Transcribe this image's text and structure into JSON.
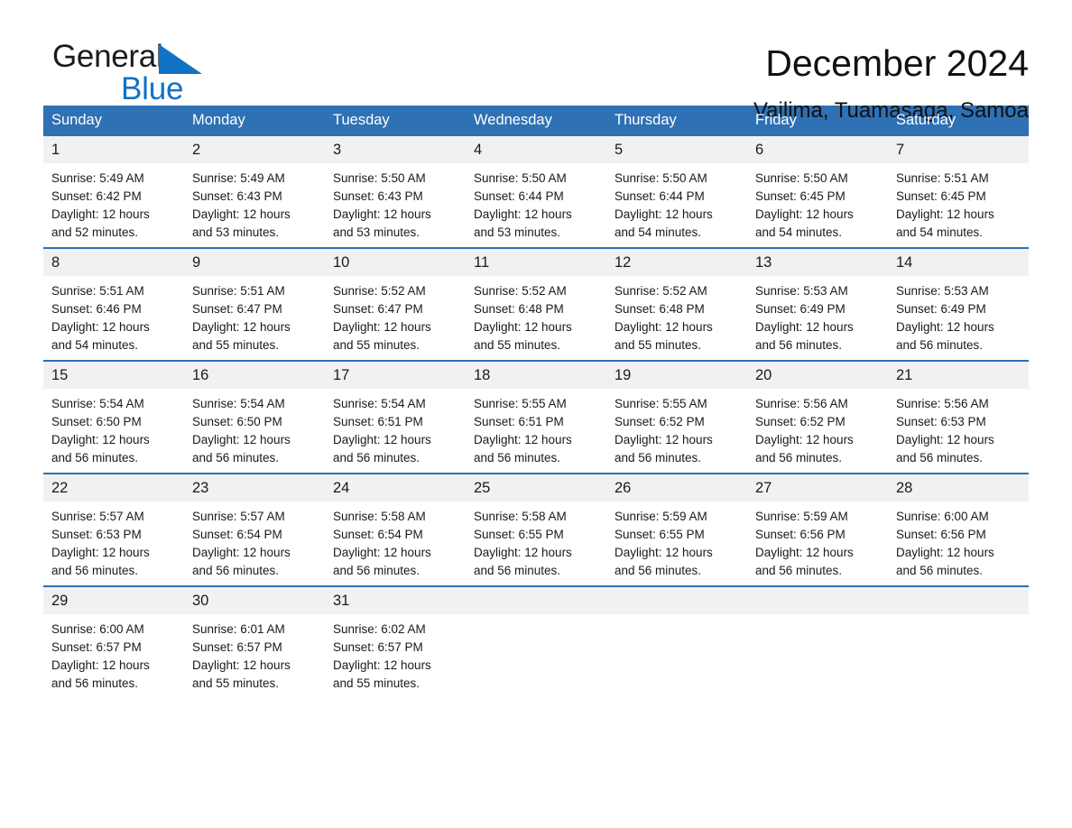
{
  "brand": {
    "name_top": "General",
    "name_bottom": "Blue",
    "triangle_icon": "blue-triangle-icon",
    "accent_color": "#1272c4"
  },
  "header": {
    "month_title": "December 2024",
    "location": "Vailima, Tuamasaga, Samoa"
  },
  "calendar": {
    "header_color": "#2e71b4",
    "daynum_band_color": "#f1f1f1",
    "weekday_headers": [
      "Sunday",
      "Monday",
      "Tuesday",
      "Wednesday",
      "Thursday",
      "Friday",
      "Saturday"
    ],
    "weeks": [
      [
        {
          "day": "1",
          "sunrise": "Sunrise: 5:49 AM",
          "sunset": "Sunset: 6:42 PM",
          "daylight_1": "Daylight: 12 hours",
          "daylight_2": "and 52 minutes."
        },
        {
          "day": "2",
          "sunrise": "Sunrise: 5:49 AM",
          "sunset": "Sunset: 6:43 PM",
          "daylight_1": "Daylight: 12 hours",
          "daylight_2": "and 53 minutes."
        },
        {
          "day": "3",
          "sunrise": "Sunrise: 5:50 AM",
          "sunset": "Sunset: 6:43 PM",
          "daylight_1": "Daylight: 12 hours",
          "daylight_2": "and 53 minutes."
        },
        {
          "day": "4",
          "sunrise": "Sunrise: 5:50 AM",
          "sunset": "Sunset: 6:44 PM",
          "daylight_1": "Daylight: 12 hours",
          "daylight_2": "and 53 minutes."
        },
        {
          "day": "5",
          "sunrise": "Sunrise: 5:50 AM",
          "sunset": "Sunset: 6:44 PM",
          "daylight_1": "Daylight: 12 hours",
          "daylight_2": "and 54 minutes."
        },
        {
          "day": "6",
          "sunrise": "Sunrise: 5:50 AM",
          "sunset": "Sunset: 6:45 PM",
          "daylight_1": "Daylight: 12 hours",
          "daylight_2": "and 54 minutes."
        },
        {
          "day": "7",
          "sunrise": "Sunrise: 5:51 AM",
          "sunset": "Sunset: 6:45 PM",
          "daylight_1": "Daylight: 12 hours",
          "daylight_2": "and 54 minutes."
        }
      ],
      [
        {
          "day": "8",
          "sunrise": "Sunrise: 5:51 AM",
          "sunset": "Sunset: 6:46 PM",
          "daylight_1": "Daylight: 12 hours",
          "daylight_2": "and 54 minutes."
        },
        {
          "day": "9",
          "sunrise": "Sunrise: 5:51 AM",
          "sunset": "Sunset: 6:47 PM",
          "daylight_1": "Daylight: 12 hours",
          "daylight_2": "and 55 minutes."
        },
        {
          "day": "10",
          "sunrise": "Sunrise: 5:52 AM",
          "sunset": "Sunset: 6:47 PM",
          "daylight_1": "Daylight: 12 hours",
          "daylight_2": "and 55 minutes."
        },
        {
          "day": "11",
          "sunrise": "Sunrise: 5:52 AM",
          "sunset": "Sunset: 6:48 PM",
          "daylight_1": "Daylight: 12 hours",
          "daylight_2": "and 55 minutes."
        },
        {
          "day": "12",
          "sunrise": "Sunrise: 5:52 AM",
          "sunset": "Sunset: 6:48 PM",
          "daylight_1": "Daylight: 12 hours",
          "daylight_2": "and 55 minutes."
        },
        {
          "day": "13",
          "sunrise": "Sunrise: 5:53 AM",
          "sunset": "Sunset: 6:49 PM",
          "daylight_1": "Daylight: 12 hours",
          "daylight_2": "and 56 minutes."
        },
        {
          "day": "14",
          "sunrise": "Sunrise: 5:53 AM",
          "sunset": "Sunset: 6:49 PM",
          "daylight_1": "Daylight: 12 hours",
          "daylight_2": "and 56 minutes."
        }
      ],
      [
        {
          "day": "15",
          "sunrise": "Sunrise: 5:54 AM",
          "sunset": "Sunset: 6:50 PM",
          "daylight_1": "Daylight: 12 hours",
          "daylight_2": "and 56 minutes."
        },
        {
          "day": "16",
          "sunrise": "Sunrise: 5:54 AM",
          "sunset": "Sunset: 6:50 PM",
          "daylight_1": "Daylight: 12 hours",
          "daylight_2": "and 56 minutes."
        },
        {
          "day": "17",
          "sunrise": "Sunrise: 5:54 AM",
          "sunset": "Sunset: 6:51 PM",
          "daylight_1": "Daylight: 12 hours",
          "daylight_2": "and 56 minutes."
        },
        {
          "day": "18",
          "sunrise": "Sunrise: 5:55 AM",
          "sunset": "Sunset: 6:51 PM",
          "daylight_1": "Daylight: 12 hours",
          "daylight_2": "and 56 minutes."
        },
        {
          "day": "19",
          "sunrise": "Sunrise: 5:55 AM",
          "sunset": "Sunset: 6:52 PM",
          "daylight_1": "Daylight: 12 hours",
          "daylight_2": "and 56 minutes."
        },
        {
          "day": "20",
          "sunrise": "Sunrise: 5:56 AM",
          "sunset": "Sunset: 6:52 PM",
          "daylight_1": "Daylight: 12 hours",
          "daylight_2": "and 56 minutes."
        },
        {
          "day": "21",
          "sunrise": "Sunrise: 5:56 AM",
          "sunset": "Sunset: 6:53 PM",
          "daylight_1": "Daylight: 12 hours",
          "daylight_2": "and 56 minutes."
        }
      ],
      [
        {
          "day": "22",
          "sunrise": "Sunrise: 5:57 AM",
          "sunset": "Sunset: 6:53 PM",
          "daylight_1": "Daylight: 12 hours",
          "daylight_2": "and 56 minutes."
        },
        {
          "day": "23",
          "sunrise": "Sunrise: 5:57 AM",
          "sunset": "Sunset: 6:54 PM",
          "daylight_1": "Daylight: 12 hours",
          "daylight_2": "and 56 minutes."
        },
        {
          "day": "24",
          "sunrise": "Sunrise: 5:58 AM",
          "sunset": "Sunset: 6:54 PM",
          "daylight_1": "Daylight: 12 hours",
          "daylight_2": "and 56 minutes."
        },
        {
          "day": "25",
          "sunrise": "Sunrise: 5:58 AM",
          "sunset": "Sunset: 6:55 PM",
          "daylight_1": "Daylight: 12 hours",
          "daylight_2": "and 56 minutes."
        },
        {
          "day": "26",
          "sunrise": "Sunrise: 5:59 AM",
          "sunset": "Sunset: 6:55 PM",
          "daylight_1": "Daylight: 12 hours",
          "daylight_2": "and 56 minutes."
        },
        {
          "day": "27",
          "sunrise": "Sunrise: 5:59 AM",
          "sunset": "Sunset: 6:56 PM",
          "daylight_1": "Daylight: 12 hours",
          "daylight_2": "and 56 minutes."
        },
        {
          "day": "28",
          "sunrise": "Sunrise: 6:00 AM",
          "sunset": "Sunset: 6:56 PM",
          "daylight_1": "Daylight: 12 hours",
          "daylight_2": "and 56 minutes."
        }
      ],
      [
        {
          "day": "29",
          "sunrise": "Sunrise: 6:00 AM",
          "sunset": "Sunset: 6:57 PM",
          "daylight_1": "Daylight: 12 hours",
          "daylight_2": "and 56 minutes."
        },
        {
          "day": "30",
          "sunrise": "Sunrise: 6:01 AM",
          "sunset": "Sunset: 6:57 PM",
          "daylight_1": "Daylight: 12 hours",
          "daylight_2": "and 55 minutes."
        },
        {
          "day": "31",
          "sunrise": "Sunrise: 6:02 AM",
          "sunset": "Sunset: 6:57 PM",
          "daylight_1": "Daylight: 12 hours",
          "daylight_2": "and 55 minutes."
        },
        {
          "day": "",
          "sunrise": "",
          "sunset": "",
          "daylight_1": "",
          "daylight_2": ""
        },
        {
          "day": "",
          "sunrise": "",
          "sunset": "",
          "daylight_1": "",
          "daylight_2": ""
        },
        {
          "day": "",
          "sunrise": "",
          "sunset": "",
          "daylight_1": "",
          "daylight_2": ""
        },
        {
          "day": "",
          "sunrise": "",
          "sunset": "",
          "daylight_1": "",
          "daylight_2": ""
        }
      ]
    ]
  }
}
